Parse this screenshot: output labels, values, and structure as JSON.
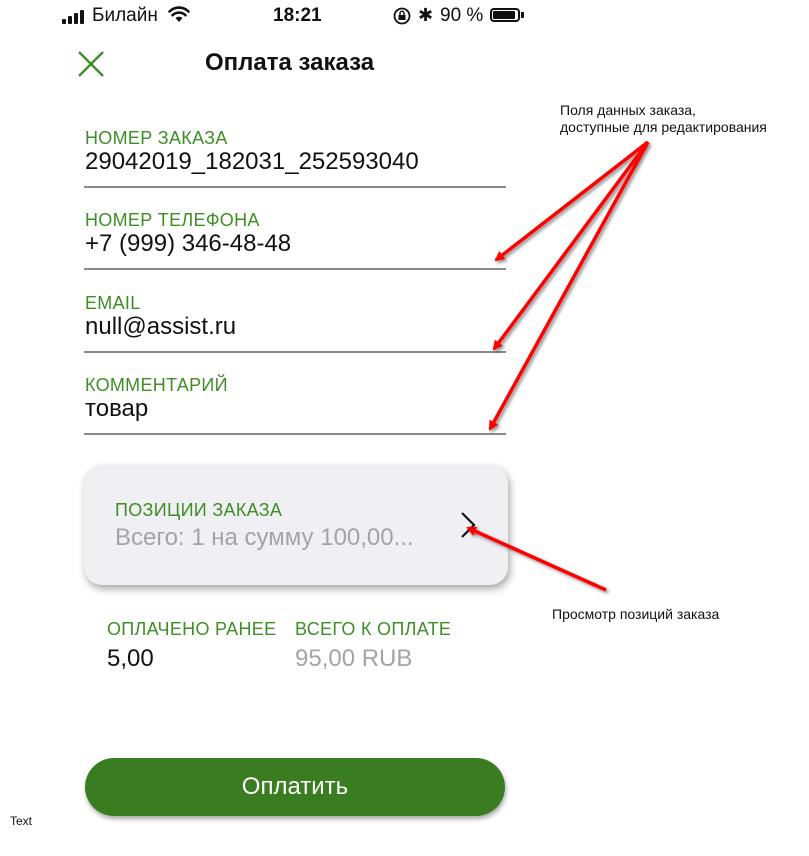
{
  "status_bar": {
    "carrier": "Билайн",
    "time": "18:21",
    "battery_percent": "90 %"
  },
  "header": {
    "title": "Оплата заказа"
  },
  "form": {
    "order_number": {
      "label": "НОМЕР ЗАКАЗА",
      "value": "29042019_182031_252593040"
    },
    "phone": {
      "label": "НОМЕР ТЕЛЕФОНА",
      "value": "+7 (999) 346-48-48"
    },
    "email": {
      "label": "EMAIL",
      "value": "null@assist.ru"
    },
    "comment": {
      "label": "КОММЕНТАРИЙ",
      "value": "товар"
    }
  },
  "order_items": {
    "label": "ПОЗИЦИИ ЗАКАЗА",
    "summary": "Всего: 1 на сумму 100,00..."
  },
  "totals": {
    "paid_label": "ОПЛАЧЕНО РАНЕЕ",
    "paid_value": "5,00",
    "due_label": "ВСЕГО К ОПЛАТЕ",
    "due_value": "95,00 RUB"
  },
  "pay_button": {
    "label": "Оплатить"
  },
  "annotations": {
    "editable_fields_line1": "Поля данных заказа,",
    "editable_fields_line2": "доступные для редактирования",
    "view_items": "Просмотр позиций заказа",
    "text_label": "Text"
  },
  "colors": {
    "accent_green": "#3e8e26",
    "button_green": "#3a7d20",
    "arrow_red": "#ff0000",
    "card_bg": "#efeff4"
  },
  "icons": [
    "signal-icon",
    "wifi-icon",
    "rotation-lock-icon",
    "bluetooth-icon",
    "battery-icon",
    "close-icon",
    "chevron-right-icon"
  ]
}
